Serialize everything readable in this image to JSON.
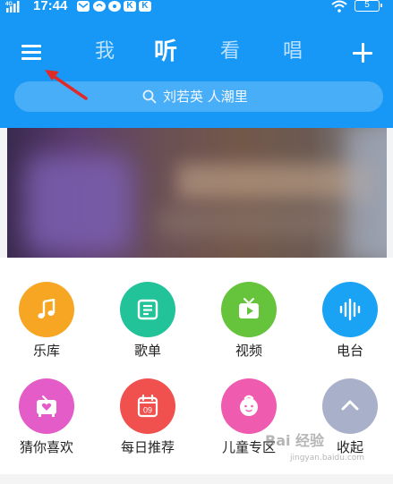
{
  "status_bar": {
    "time": "17:44",
    "notif_badges": [
      "K",
      "K"
    ],
    "battery": "5"
  },
  "nav": {
    "tabs": [
      "我",
      "听",
      "看",
      "唱"
    ],
    "active_tab": "听"
  },
  "search": {
    "text": "刘若英 人潮里"
  },
  "grid": {
    "items": [
      {
        "label": "乐库",
        "color": "#f6a623",
        "icon": "music-note-icon"
      },
      {
        "label": "歌单",
        "color": "#23c39a",
        "icon": "playlist-icon"
      },
      {
        "label": "视频",
        "color": "#66c43c",
        "icon": "tv-play-icon"
      },
      {
        "label": "电台",
        "color": "#1aa3f4",
        "icon": "soundwave-icon"
      },
      {
        "label": "猜你喜欢",
        "color": "#e35cc7",
        "icon": "radio-heart-icon"
      },
      {
        "label": "每日推荐",
        "color": "#f0504e",
        "icon": "calendar-icon"
      },
      {
        "label": "儿童专区",
        "color": "#ef5bae",
        "icon": "child-face-icon"
      },
      {
        "label": "收起",
        "color": "#a9b0c9",
        "icon": "chevron-up-icon"
      }
    ],
    "calendar_day": "09"
  },
  "watermark": {
    "main": "Bai 经验",
    "sub": "jingyan.baidu.com"
  },
  "colors": {
    "header_blue": "#1798f6",
    "annotation_arrow": "#e02a2a"
  }
}
